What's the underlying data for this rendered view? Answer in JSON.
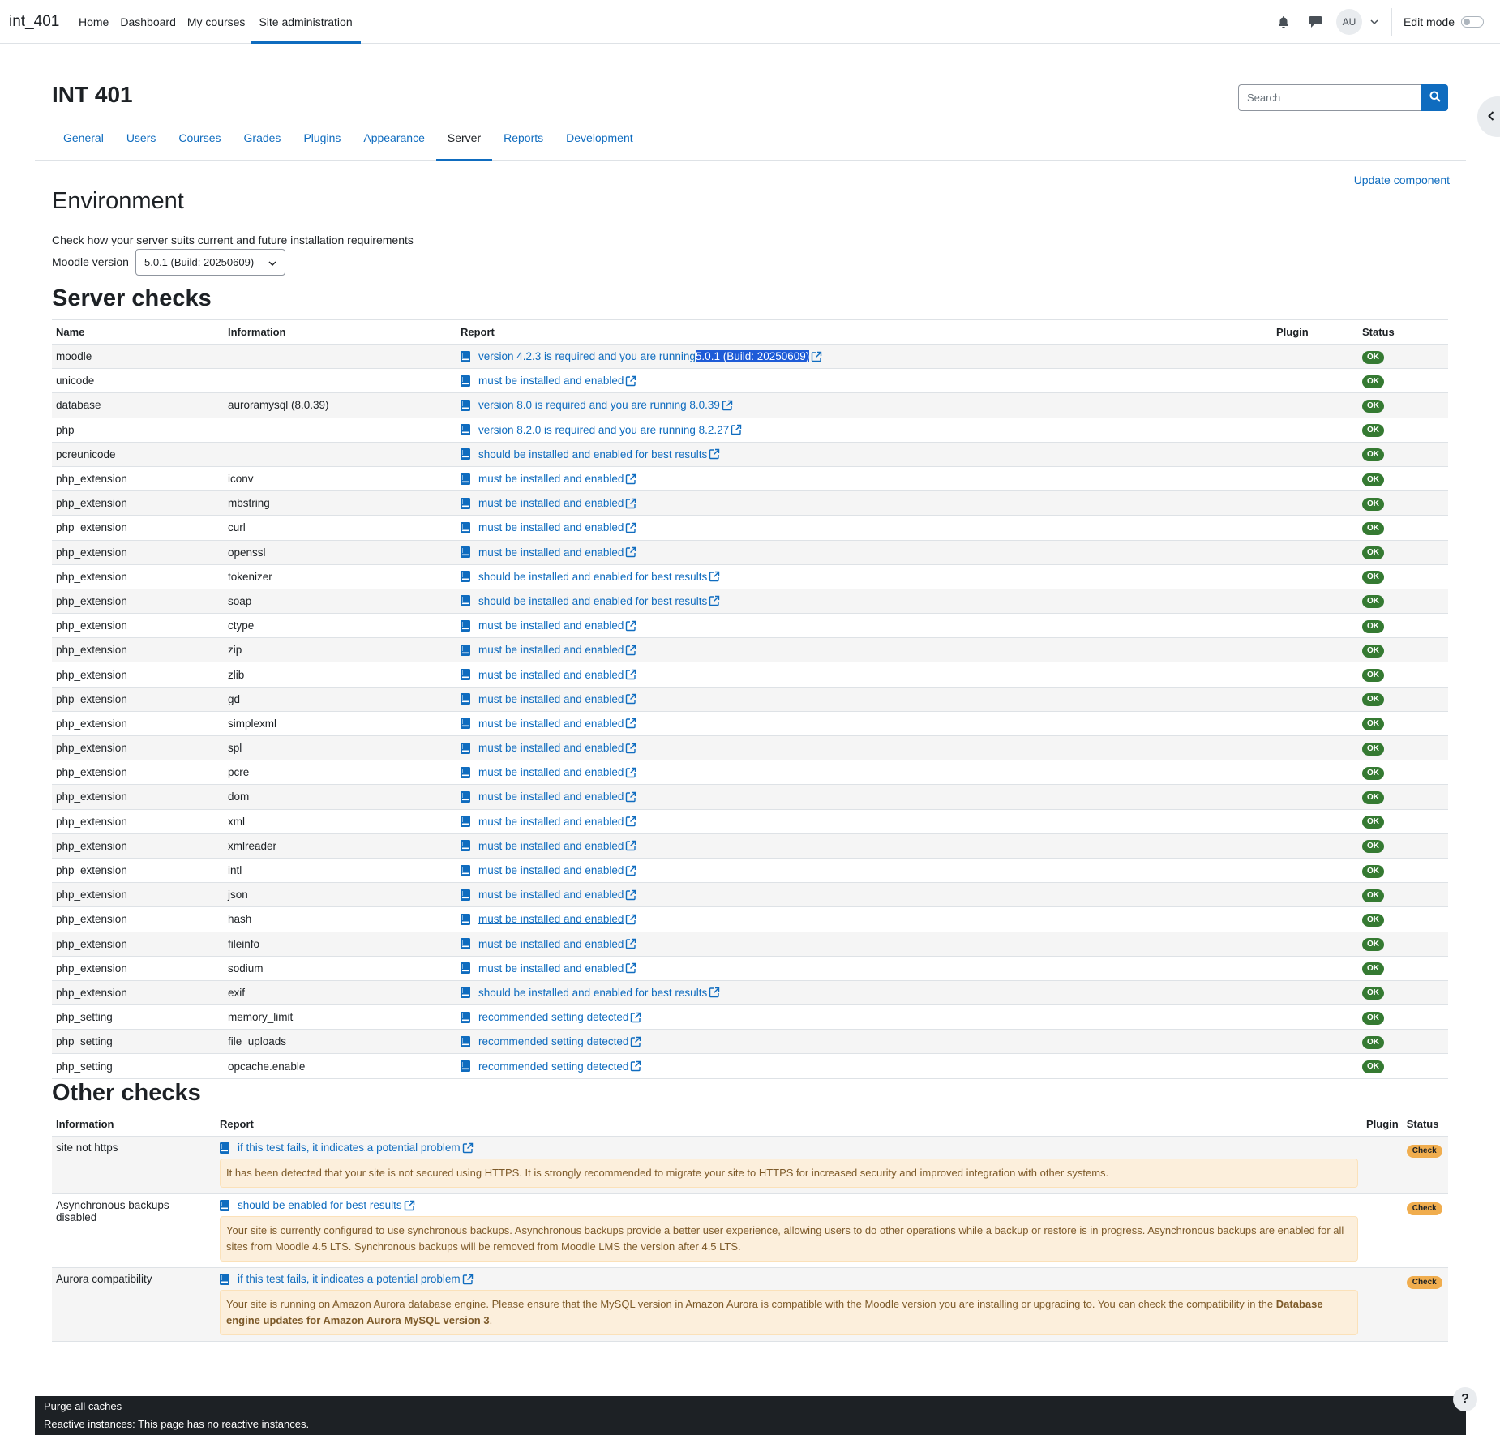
{
  "navbar": {
    "brand": "int_401",
    "items": [
      {
        "label": "Home"
      },
      {
        "label": "Dashboard"
      },
      {
        "label": "My courses"
      },
      {
        "label": "Site administration"
      }
    ],
    "avatar": "AU",
    "edit_mode_label": "Edit mode"
  },
  "page": {
    "title": "INT 401",
    "search_placeholder": "Search",
    "tabs": [
      {
        "label": "General"
      },
      {
        "label": "Users"
      },
      {
        "label": "Courses"
      },
      {
        "label": "Grades"
      },
      {
        "label": "Plugins"
      },
      {
        "label": "Appearance"
      },
      {
        "label": "Server"
      },
      {
        "label": "Reports"
      },
      {
        "label": "Development"
      }
    ],
    "active_tab": "Server",
    "update_component": "Update component"
  },
  "environment": {
    "heading": "Environment",
    "description": "Check how your server suits current and future installation requirements",
    "moodle_version_label": "Moodle version",
    "moodle_version_value": "5.0.1 (Build: 20250609)"
  },
  "server_checks": {
    "heading": "Server checks",
    "columns": [
      "Name",
      "Information",
      "Report",
      "Plugin",
      "Status"
    ],
    "rows": [
      {
        "name": "moodle",
        "info": "",
        "report": "version 4.2.3 is required and you are running ",
        "highlight": "5.0.1 (Build: 20250609)",
        "status": "OK"
      },
      {
        "name": "unicode",
        "info": "",
        "report": "must be installed and enabled",
        "status": "OK"
      },
      {
        "name": "database",
        "info": "auroramysql (8.0.39)",
        "report": "version 8.0 is required and you are running 8.0.39",
        "status": "OK"
      },
      {
        "name": "php",
        "info": "",
        "report": "version 8.2.0 is required and you are running 8.2.27",
        "status": "OK"
      },
      {
        "name": "pcreunicode",
        "info": "",
        "report": "should be installed and enabled for best results",
        "status": "OK"
      },
      {
        "name": "php_extension",
        "info": "iconv",
        "report": "must be installed and enabled",
        "status": "OK"
      },
      {
        "name": "php_extension",
        "info": "mbstring",
        "report": "must be installed and enabled",
        "status": "OK"
      },
      {
        "name": "php_extension",
        "info": "curl",
        "report": "must be installed and enabled",
        "status": "OK"
      },
      {
        "name": "php_extension",
        "info": "openssl",
        "report": "must be installed and enabled",
        "status": "OK"
      },
      {
        "name": "php_extension",
        "info": "tokenizer",
        "report": "should be installed and enabled for best results",
        "status": "OK"
      },
      {
        "name": "php_extension",
        "info": "soap",
        "report": "should be installed and enabled for best results",
        "status": "OK"
      },
      {
        "name": "php_extension",
        "info": "ctype",
        "report": "must be installed and enabled",
        "status": "OK"
      },
      {
        "name": "php_extension",
        "info": "zip",
        "report": "must be installed and enabled",
        "status": "OK"
      },
      {
        "name": "php_extension",
        "info": "zlib",
        "report": "must be installed and enabled",
        "status": "OK"
      },
      {
        "name": "php_extension",
        "info": "gd",
        "report": "must be installed and enabled",
        "status": "OK"
      },
      {
        "name": "php_extension",
        "info": "simplexml",
        "report": "must be installed and enabled",
        "status": "OK"
      },
      {
        "name": "php_extension",
        "info": "spl",
        "report": "must be installed and enabled",
        "status": "OK"
      },
      {
        "name": "php_extension",
        "info": "pcre",
        "report": "must be installed and enabled",
        "status": "OK"
      },
      {
        "name": "php_extension",
        "info": "dom",
        "report": "must be installed and enabled",
        "status": "OK"
      },
      {
        "name": "php_extension",
        "info": "xml",
        "report": "must be installed and enabled",
        "status": "OK"
      },
      {
        "name": "php_extension",
        "info": "xmlreader",
        "report": "must be installed and enabled",
        "status": "OK"
      },
      {
        "name": "php_extension",
        "info": "intl",
        "report": "must be installed and enabled",
        "status": "OK"
      },
      {
        "name": "php_extension",
        "info": "json",
        "report": "must be installed and enabled",
        "status": "OK"
      },
      {
        "name": "php_extension",
        "info": "hash",
        "report": "must be installed and enabled",
        "status": "OK",
        "underline": true
      },
      {
        "name": "php_extension",
        "info": "fileinfo",
        "report": "must be installed and enabled",
        "status": "OK"
      },
      {
        "name": "php_extension",
        "info": "sodium",
        "report": "must be installed and enabled",
        "status": "OK"
      },
      {
        "name": "php_extension",
        "info": "exif",
        "report": "should be installed and enabled for best results",
        "status": "OK"
      },
      {
        "name": "php_setting",
        "info": "memory_limit",
        "report": "recommended setting detected",
        "status": "OK"
      },
      {
        "name": "php_setting",
        "info": "file_uploads",
        "report": "recommended setting detected",
        "status": "OK"
      },
      {
        "name": "php_setting",
        "info": "opcache.enable",
        "report": "recommended setting detected",
        "status": "OK"
      }
    ]
  },
  "other_checks": {
    "heading": "Other checks",
    "columns": [
      "Information",
      "Report",
      "Plugin",
      "Status"
    ],
    "rows": [
      {
        "info": "site not https",
        "report": "if this test fails, it indicates a potential problem",
        "status": "Check",
        "alert": "It has been detected that your site is not secured using HTTPS. It is strongly recommended to migrate your site to HTTPS for increased security and improved integration with other systems."
      },
      {
        "info": "Asynchronous backups disabled",
        "report": "should be enabled for best results",
        "status": "Check",
        "alert": "Your site is currently configured to use synchronous backups. Asynchronous backups provide a better user experience, allowing users to do other operations while a backup or restore is in progress. Asynchronous backups are enabled for all sites from Moodle 4.5 LTS. Synchronous backups will be removed from Moodle LMS the version after 4.5 LTS."
      },
      {
        "info": "Aurora compatibility",
        "report": "if this test fails, it indicates a potential problem",
        "status": "Check",
        "alert": "Your site is running on Amazon Aurora database engine. Please ensure that the MySQL version in Amazon Aurora is compatible with the Moodle version you are installing or upgrading to. You can check the compatibility in the ",
        "alert_bold": "Database engine updates for Amazon Aurora MySQL version 3",
        "alert_end": "."
      }
    ]
  },
  "footer": {
    "purge": "Purge all caches",
    "reactive": "Reactive instances: This page has no reactive instances."
  },
  "help_label": "?",
  "colors": {
    "accent": "#0f6cbf",
    "ok": "#357a32",
    "check": "#f0ad4e",
    "footer": "#1d2125"
  }
}
